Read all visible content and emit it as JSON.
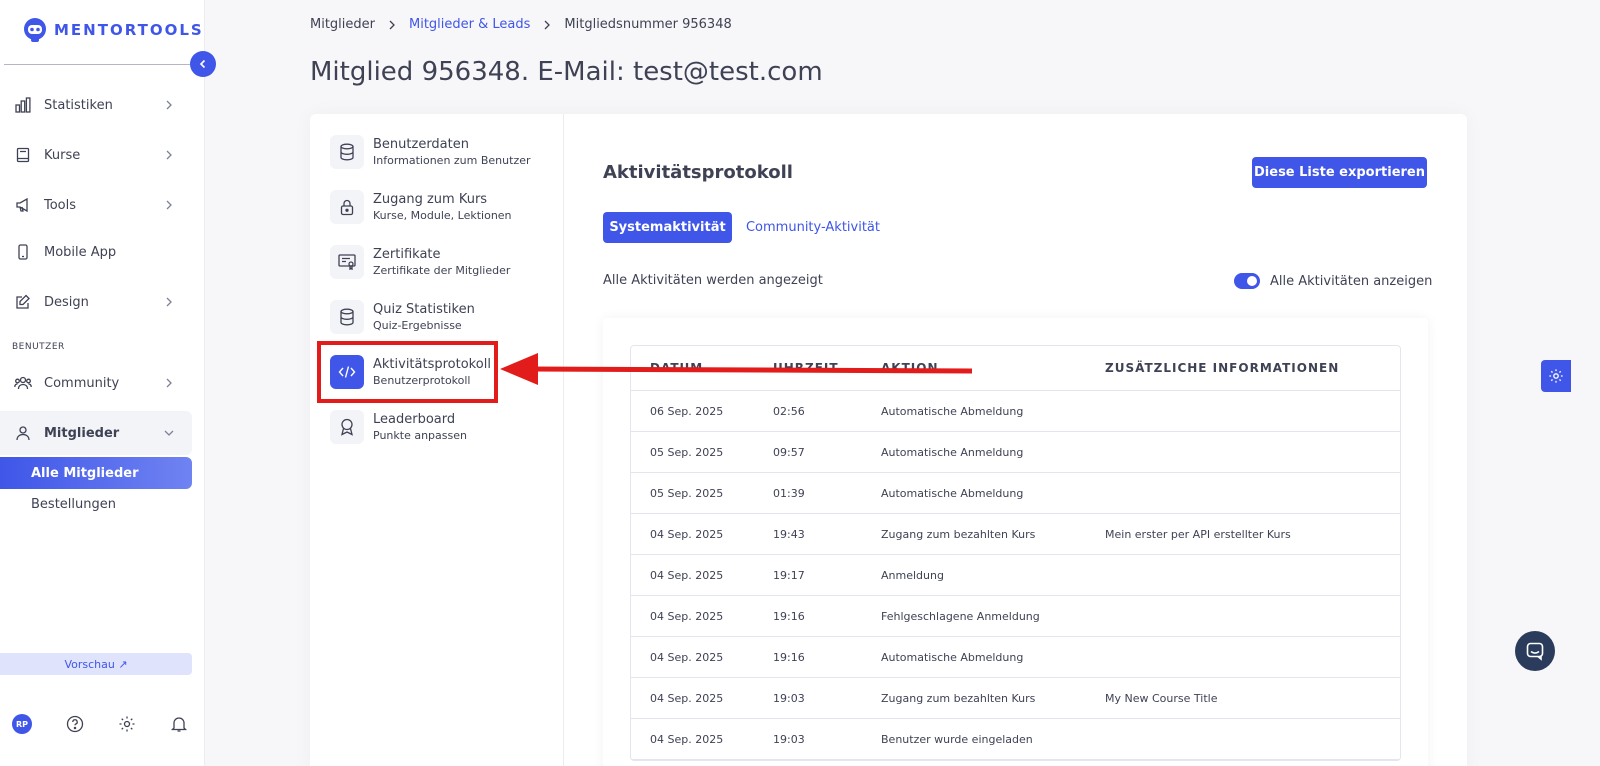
{
  "app": {
    "logo_text": "MENTORTOOLS"
  },
  "sidebar": {
    "items": [
      {
        "label": "Statistiken",
        "icon": "bar-chart-icon"
      },
      {
        "label": "Kurse",
        "icon": "book-icon"
      },
      {
        "label": "Tools",
        "icon": "megaphone-icon"
      },
      {
        "label": "Mobile App",
        "icon": "phone-icon"
      },
      {
        "label": "Design",
        "icon": "edit-icon"
      }
    ],
    "section_label": "BENUTZER",
    "community": {
      "label": "Community",
      "icon": "users-icon"
    },
    "members": {
      "label": "Mitglieder",
      "icon": "user-icon"
    },
    "sub_items": [
      {
        "label": "Alle Mitglieder"
      },
      {
        "label": "Bestellungen"
      }
    ],
    "preview_label": "Vorschau ↗",
    "avatar_initials": "RP"
  },
  "breadcrumb": {
    "items": [
      "Mitglieder",
      "Mitglieder & Leads",
      "Mitgliedsnummer 956348"
    ]
  },
  "page_title": "Mitglied 956348. E-Mail: test@test.com",
  "submenu": [
    {
      "title": "Benutzerdaten",
      "desc": "Informationen zum Benutzer",
      "icon": "database-icon"
    },
    {
      "title": "Zugang zum Kurs",
      "desc": "Kurse, Module, Lektionen",
      "icon": "lock-icon"
    },
    {
      "title": "Zertifikate",
      "desc": "Zertifikate der Mitglieder",
      "icon": "certificate-icon"
    },
    {
      "title": "Quiz Statistiken",
      "desc": "Quiz-Ergebnisse",
      "icon": "database-icon"
    },
    {
      "title": "Aktivitätsprotokoll",
      "desc": "Benutzerprotokoll",
      "icon": "code-icon"
    },
    {
      "title": "Leaderboard",
      "desc": "Punkte anpassen",
      "icon": "award-icon"
    }
  ],
  "main": {
    "section_title": "Aktivitätsprotokoll",
    "export_label": "Diese Liste exportieren",
    "tabs": [
      {
        "label": "Systemaktivität"
      },
      {
        "label": "Community-Aktivität"
      }
    ],
    "filter_text": "Alle Aktivitäten werden angezeigt",
    "toggle_label": "Alle Aktivitäten anzeigen"
  },
  "table": {
    "headers": [
      "DATUM",
      "UHRZEIT",
      "AKTION",
      "ZUSÄTZLICHE INFORMATIONEN"
    ],
    "rows": [
      [
        "06 Sep. 2025",
        "02:56",
        "Automatische Abmeldung",
        ""
      ],
      [
        "05 Sep. 2025",
        "09:57",
        "Automatische Anmeldung",
        ""
      ],
      [
        "05 Sep. 2025",
        "01:39",
        "Automatische Abmeldung",
        ""
      ],
      [
        "04 Sep. 2025",
        "19:43",
        "Zugang zum bezahlten Kurs",
        "Mein erster per API erstellter Kurs"
      ],
      [
        "04 Sep. 2025",
        "19:17",
        "Anmeldung",
        ""
      ],
      [
        "04 Sep. 2025",
        "19:16",
        "Fehlgeschlagene Anmeldung",
        ""
      ],
      [
        "04 Sep. 2025",
        "19:16",
        "Automatische Abmeldung",
        ""
      ],
      [
        "04 Sep. 2025",
        "19:03",
        "Zugang zum bezahlten Kurs",
        "My New Course Title"
      ],
      [
        "04 Sep. 2025",
        "19:03",
        "Benutzer wurde eingeladen",
        ""
      ]
    ]
  },
  "colors": {
    "accent": "#3f56e8",
    "annotation": "#e21b1b"
  }
}
